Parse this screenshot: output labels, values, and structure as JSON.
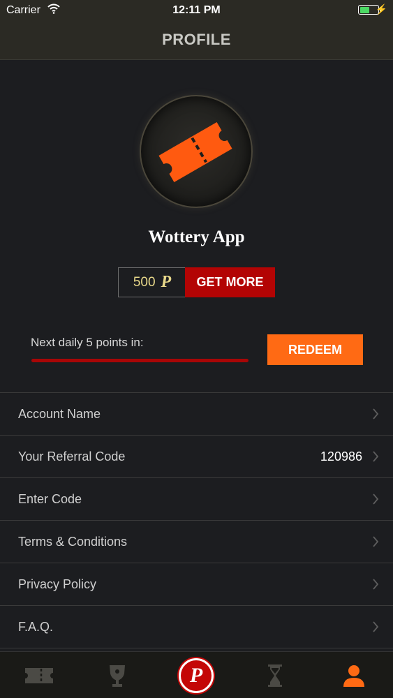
{
  "status_bar": {
    "carrier": "Carrier",
    "time": "12:11 PM",
    "battery_level": 0.55
  },
  "navbar": {
    "title": "PROFILE"
  },
  "profile": {
    "app_name": "Wottery App",
    "avatar_icon": "ticket-icon",
    "points_value": "500",
    "points_glyph": "P",
    "get_more_label": "GET MORE"
  },
  "daily": {
    "label": "Next daily 5 points in:",
    "progress": 1.0,
    "redeem_label": "REDEEM"
  },
  "menu": {
    "items": [
      {
        "label": "Account Name",
        "value": ""
      },
      {
        "label": "Your Referral Code",
        "value": "120986"
      },
      {
        "label": "Enter Code",
        "value": ""
      },
      {
        "label": "Terms & Conditions",
        "value": ""
      },
      {
        "label": "Privacy Policy",
        "value": ""
      },
      {
        "label": "F.A.Q.",
        "value": ""
      }
    ]
  },
  "tabbar": {
    "tabs": [
      {
        "icon": "ticket-icon",
        "active": false
      },
      {
        "icon": "trophy-icon",
        "active": false
      },
      {
        "icon": "points-icon",
        "label": "P",
        "active": false
      },
      {
        "icon": "hourglass-icon",
        "active": false
      },
      {
        "icon": "person-icon",
        "active": true
      }
    ]
  },
  "colors": {
    "accent_orange": "#ff6a14",
    "accent_red": "#b30404",
    "points_gold": "#e8d88a",
    "background": "#1c1d20"
  }
}
